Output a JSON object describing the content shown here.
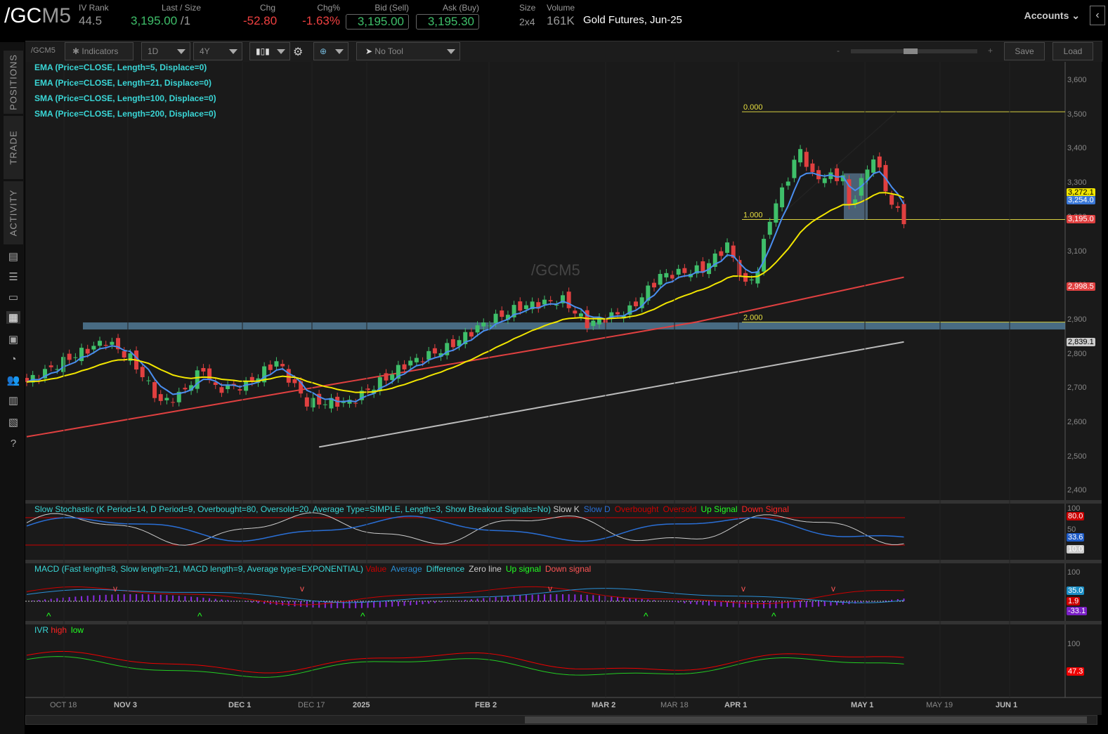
{
  "header": {
    "symbol_a": "/GC",
    "symbol_b": "M5",
    "iv_rank_label": "IV Rank",
    "iv_rank": "44.5",
    "last_label": "Last / Size",
    "last": "3,195.00",
    "size": "/1",
    "chg_label": "Chg",
    "chg": "-52.80",
    "chgpct_label": "Chg%",
    "chgpct": "-1.63%",
    "bid_label": "Bid (Sell)",
    "bid": "3,195.00",
    "ask_label": "Ask (Buy)",
    "ask": "3,195.30",
    "size_label": "Size",
    "size_val": "2x4",
    "volume_label": "Volume",
    "volume": "161K",
    "description": "Gold Futures, Jun-25",
    "accounts": "Accounts"
  },
  "sidebar": {
    "tabs": [
      "POSITIONS",
      "TRADE",
      "ACTIVITY"
    ]
  },
  "toolbar": {
    "symbol": "/GCM5",
    "indicators": "Indicators",
    "aggregation": "1D",
    "timeframe": "4Y",
    "tool": "No Tool",
    "zoom_minus": "-",
    "zoom_plus": "+",
    "save": "Save",
    "load": "Load"
  },
  "studies": [
    "EMA (Price=CLOSE, Length=5, Displace=0)",
    "EMA (Price=CLOSE, Length=21, Displace=0)",
    "SMA (Price=CLOSE, Length=100, Displace=0)",
    "SMA (Price=CLOSE, Length=200, Displace=0)"
  ],
  "watermark": "/GCM5",
  "fib": {
    "f0": "0.000",
    "f1": "1.000",
    "f2": "2.000"
  },
  "price_axis": {
    "ticks": [
      "3,600",
      "3,500",
      "3,400",
      "3,300",
      "3,200",
      "3,100",
      "3,000",
      "2,900",
      "2,800",
      "2,700",
      "2,600",
      "2,500",
      "2,400"
    ],
    "labels": [
      {
        "text": "3,272.1",
        "bg": "#f2e600",
        "fg": "#000"
      },
      {
        "text": "3,254.0",
        "bg": "#3a78d8",
        "fg": "#fff"
      },
      {
        "text": "3,195.0",
        "bg": "#e04040",
        "fg": "#fff"
      },
      {
        "text": "2,998.5",
        "bg": "#e04040",
        "fg": "#fff"
      },
      {
        "text": "2,839.1",
        "bg": "#ccc",
        "fg": "#000"
      }
    ]
  },
  "stoch": {
    "title": "Slow Stochastic (K Period=14, D Period=9, Overbought=80, Oversold=20, Average Type=SIMPLE, Length=3, Show Breakout Signals=No)",
    "legend": [
      {
        "t": "Slow K",
        "c": "#ccc"
      },
      {
        "t": "Slow D",
        "c": "#2a6fd6"
      },
      {
        "t": "Overbought",
        "c": "#c00"
      },
      {
        "t": "Oversold",
        "c": "#c00"
      },
      {
        "t": "Up Signal",
        "c": "#2f2"
      },
      {
        "t": "Down Signal",
        "c": "#f22"
      }
    ],
    "axis": [
      "100",
      "50"
    ],
    "labels": [
      {
        "text": "80.0",
        "bg": "#c00"
      },
      {
        "text": "33.6",
        "bg": "#1e5bc6"
      },
      {
        "text": "10.0",
        "bg": "#ccc"
      }
    ]
  },
  "macd": {
    "title": "MACD (Fast length=8, Slow length=21, MACD length=9, Average type=EXPONENTIAL)",
    "legend": [
      {
        "t": "Value",
        "c": "#c00"
      },
      {
        "t": "Average",
        "c": "#2a8fd6"
      },
      {
        "t": "Difference",
        "c": "#3ad6d6"
      },
      {
        "t": "Zero line",
        "c": "#ccc"
      },
      {
        "t": "Up signal",
        "c": "#2f2"
      },
      {
        "t": "Down signal",
        "c": "#f55"
      }
    ],
    "axis": [
      "100"
    ],
    "labels": [
      {
        "text": "35.0",
        "bg": "#1b8fc6"
      },
      {
        "text": "1.9",
        "bg": "#c00"
      },
      {
        "text": "-33.1",
        "bg": "#7a1fc6"
      }
    ]
  },
  "ivr": {
    "title": "IVR",
    "legend": [
      {
        "t": "high",
        "c": "#f22"
      },
      {
        "t": "low",
        "c": "#2f2"
      }
    ],
    "axis": [
      "100"
    ],
    "labels": [
      {
        "text": "47.3",
        "bg": "#e00"
      }
    ]
  },
  "date_axis": [
    {
      "t": "OCT 18",
      "b": false
    },
    {
      "t": "NOV 3",
      "b": true
    },
    {
      "t": "DEC 1",
      "b": true
    },
    {
      "t": "DEC 17",
      "b": false
    },
    {
      "t": "2025",
      "b": true
    },
    {
      "t": "FEB 2",
      "b": true
    },
    {
      "t": "MAR 2",
      "b": true
    },
    {
      "t": "MAR 18",
      "b": false
    },
    {
      "t": "APR 1",
      "b": true
    },
    {
      "t": "MAY 1",
      "b": true
    },
    {
      "t": "MAY 19",
      "b": false
    },
    {
      "t": "JUN 1",
      "b": true
    }
  ],
  "colors": {
    "up": "#3fbf6a",
    "down": "#e04040",
    "ema5": "#4a8ef0",
    "ema21": "#f2e600",
    "sma100": "#e04040",
    "sma200": "#bbbbbb"
  },
  "price_path": [
    [
      0,
      2720
    ],
    [
      7,
      2790
    ],
    [
      13,
      2840
    ],
    [
      17,
      2790
    ],
    [
      22,
      2660
    ],
    [
      25,
      2680
    ],
    [
      29,
      2760
    ],
    [
      31,
      2700
    ],
    [
      36,
      2710
    ],
    [
      41,
      2780
    ],
    [
      46,
      2660
    ],
    [
      53,
      2660
    ],
    [
      58,
      2720
    ],
    [
      62,
      2770
    ],
    [
      69,
      2820
    ],
    [
      75,
      2890
    ],
    [
      81,
      2940
    ],
    [
      88,
      2960
    ],
    [
      92,
      2890
    ],
    [
      99,
      2930
    ],
    [
      104,
      3030
    ],
    [
      111,
      3050
    ],
    [
      115,
      3120
    ],
    [
      118,
      3000
    ],
    [
      120,
      3050
    ],
    [
      122,
      3200
    ],
    [
      127,
      3400
    ],
    [
      129,
      3320
    ],
    [
      134,
      3320
    ],
    [
      135,
      3230
    ],
    [
      139,
      3380
    ],
    [
      142,
      3240
    ],
    [
      144,
      3195
    ]
  ]
}
